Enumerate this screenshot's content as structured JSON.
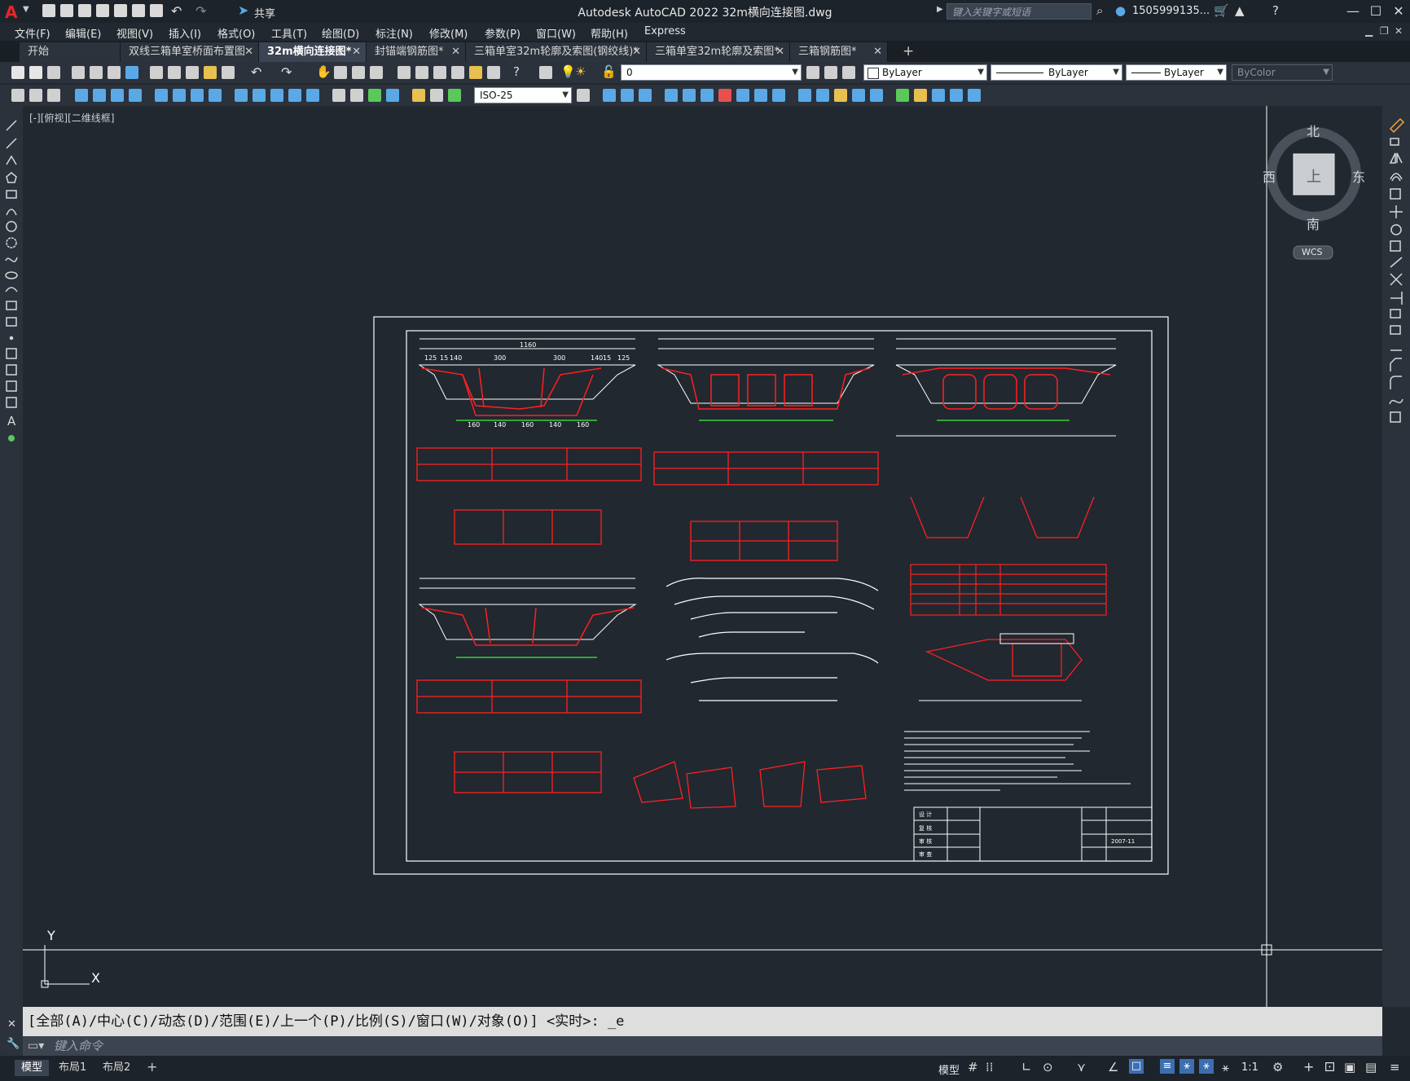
{
  "title_bar": {
    "app_logo": "A",
    "title": "Autodesk AutoCAD 2022    32m横向连接图.dwg",
    "share_label": "共享",
    "search_placeholder": "键入关键字或短语",
    "user_name": "1505999135..."
  },
  "menu": [
    "文件(F)",
    "编辑(E)",
    "视图(V)",
    "插入(I)",
    "格式(O)",
    "工具(T)",
    "绘图(D)",
    "标注(N)",
    "修改(M)",
    "参数(P)",
    "窗口(W)",
    "帮助(H)",
    "Express"
  ],
  "tabs": [
    {
      "label": "开始",
      "active": false,
      "closable": false
    },
    {
      "label": "双线三箱单室桥面布置图",
      "active": false,
      "closable": true
    },
    {
      "label": "32m横向连接图*",
      "active": true,
      "closable": true
    },
    {
      "label": "封锚端钢筋图*",
      "active": false,
      "closable": true
    },
    {
      "label": "三箱单室32m轮廓及索图(钢绞线)*",
      "active": false,
      "closable": true
    },
    {
      "label": "三箱单室32m轮廓及索图*",
      "active": false,
      "closable": true
    },
    {
      "label": "三箱钢筋图*",
      "active": false,
      "closable": true
    }
  ],
  "toolbar": {
    "layer_value": "0",
    "color_value": "ByLayer",
    "linetype_value": "ByLayer",
    "lineweight_value": "ByLayer",
    "plotstyle_value": "ByColor",
    "dimstyle_value": "ISO-25"
  },
  "viewport": {
    "label": "[-][俯视][二维线框]",
    "ucs_x": "X",
    "ucs_y": "Y"
  },
  "viewcube": {
    "north": "北",
    "south": "南",
    "east": "东",
    "west": "西",
    "face": "上",
    "wcs": "WCS"
  },
  "drawing": {
    "dim_total": "1160",
    "dim_parts_top": [
      "125",
      "15",
      "140",
      "300",
      "300",
      "140",
      "15",
      "125"
    ],
    "dim_parts_bottom": [
      "160",
      "140",
      "160",
      "140",
      "160"
    ],
    "title_block": {
      "date": "2007-11",
      "rows": [
        "设 计",
        "复 核",
        "审 核",
        "审 查"
      ]
    }
  },
  "command": {
    "history": "[全部(A)/中心(C)/动态(D)/范围(E)/上一个(P)/比例(S)/窗口(W)/对象(O)] <实时>: _e",
    "placeholder": "键入命令"
  },
  "status": {
    "layouts": [
      "模型",
      "布局1",
      "布局2"
    ],
    "model_label": "模型",
    "scale": "1:1"
  },
  "colors": {
    "accent": "#3b4452",
    "drawing_red": "#ff2020",
    "drawing_white": "#ffffff",
    "drawing_green": "#39d139",
    "background": "#212830"
  }
}
